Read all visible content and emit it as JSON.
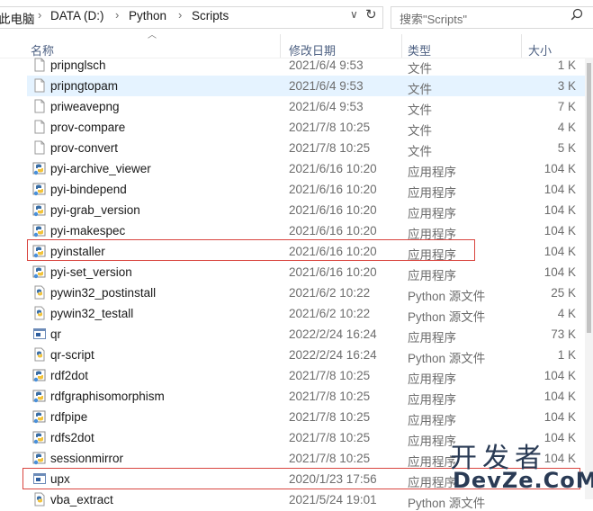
{
  "address_bar": {
    "crumbs": [
      "此电脑",
      "DATA (D:)",
      "Python",
      "Scripts"
    ],
    "search_placeholder": "搜索\"Scripts\""
  },
  "columns": {
    "name": "名称",
    "modified": "修改日期",
    "type": "类型",
    "size": "大小"
  },
  "files": [
    {
      "name": "pripnglsch",
      "date": "2021/6/4 9:53",
      "type": "文件",
      "size": "1 K",
      "icon": "blank-file-icon"
    },
    {
      "name": "pripngtopam",
      "date": "2021/6/4 9:53",
      "type": "文件",
      "size": "3 K",
      "icon": "blank-file-icon",
      "selected": true
    },
    {
      "name": "priweavepng",
      "date": "2021/6/4 9:53",
      "type": "文件",
      "size": "7 K",
      "icon": "blank-file-icon"
    },
    {
      "name": "prov-compare",
      "date": "2021/7/8 10:25",
      "type": "文件",
      "size": "4 K",
      "icon": "blank-file-icon"
    },
    {
      "name": "prov-convert",
      "date": "2021/7/8 10:25",
      "type": "文件",
      "size": "5 K",
      "icon": "blank-file-icon"
    },
    {
      "name": "pyi-archive_viewer",
      "date": "2021/6/16 10:20",
      "type": "应用程序",
      "size": "104 K",
      "icon": "python-exe-icon"
    },
    {
      "name": "pyi-bindepend",
      "date": "2021/6/16 10:20",
      "type": "应用程序",
      "size": "104 K",
      "icon": "python-exe-icon"
    },
    {
      "name": "pyi-grab_version",
      "date": "2021/6/16 10:20",
      "type": "应用程序",
      "size": "104 K",
      "icon": "python-exe-icon"
    },
    {
      "name": "pyi-makespec",
      "date": "2021/6/16 10:20",
      "type": "应用程序",
      "size": "104 K",
      "icon": "python-exe-icon"
    },
    {
      "name": "pyinstaller",
      "date": "2021/6/16 10:20",
      "type": "应用程序",
      "size": "104 K",
      "icon": "python-exe-icon"
    },
    {
      "name": "pyi-set_version",
      "date": "2021/6/16 10:20",
      "type": "应用程序",
      "size": "104 K",
      "icon": "python-exe-icon"
    },
    {
      "name": "pywin32_postinstall",
      "date": "2021/6/2 10:22",
      "type": "Python 源文件",
      "size": "25 K",
      "icon": "python-source-icon"
    },
    {
      "name": "pywin32_testall",
      "date": "2021/6/2 10:22",
      "type": "Python 源文件",
      "size": "4 K",
      "icon": "python-source-icon"
    },
    {
      "name": "qr",
      "date": "2022/2/24 16:24",
      "type": "应用程序",
      "size": "73 K",
      "icon": "exe-window-icon"
    },
    {
      "name": "qr-script",
      "date": "2022/2/24 16:24",
      "type": "Python 源文件",
      "size": "1 K",
      "icon": "python-source-icon"
    },
    {
      "name": "rdf2dot",
      "date": "2021/7/8 10:25",
      "type": "应用程序",
      "size": "104 K",
      "icon": "python-exe-icon"
    },
    {
      "name": "rdfgraphisomorphism",
      "date": "2021/7/8 10:25",
      "type": "应用程序",
      "size": "104 K",
      "icon": "python-exe-icon"
    },
    {
      "name": "rdfpipe",
      "date": "2021/7/8 10:25",
      "type": "应用程序",
      "size": "104 K",
      "icon": "python-exe-icon"
    },
    {
      "name": "rdfs2dot",
      "date": "2021/7/8 10:25",
      "type": "应用程序",
      "size": "104 K",
      "icon": "python-exe-icon"
    },
    {
      "name": "sessionmirror",
      "date": "2021/7/8 10:25",
      "type": "应用程序",
      "size": "104 K",
      "icon": "python-exe-icon"
    },
    {
      "name": "upx",
      "date": "2020/1/23 17:56",
      "type": "应用程序",
      "size": "",
      "icon": "exe-window-icon"
    },
    {
      "name": "vba_extract",
      "date": "2021/5/24 19:01",
      "type": "Python 源文件",
      "size": "",
      "icon": "python-source-icon"
    }
  ],
  "watermark": {
    "line1": "开发者",
    "line2": "DevZe.CoM"
  },
  "colors": {
    "selection": "#e5f3ff",
    "highlight_box": "#d9453f",
    "header_text": "#4d6082"
  }
}
